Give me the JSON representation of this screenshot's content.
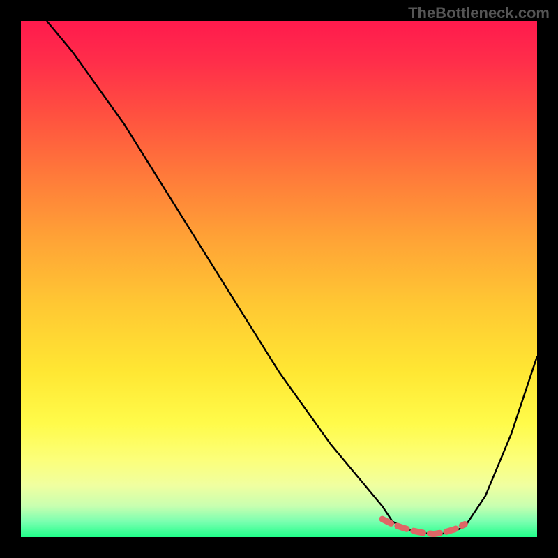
{
  "watermark": "TheBottleneck.com",
  "chart_data": {
    "type": "line",
    "title": "",
    "xlabel": "",
    "ylabel": "",
    "xlim": [
      0,
      100
    ],
    "ylim": [
      0,
      100
    ],
    "grid": false,
    "series": [
      {
        "name": "bottleneck-curve",
        "x": [
          5,
          10,
          15,
          20,
          25,
          30,
          35,
          40,
          45,
          50,
          55,
          60,
          65,
          70,
          72,
          75,
          78,
          80,
          83,
          86,
          90,
          95,
          100
        ],
        "values": [
          100,
          94,
          87,
          80,
          72,
          64,
          56,
          48,
          40,
          32,
          25,
          18,
          12,
          6,
          3,
          1.5,
          0.8,
          0.5,
          0.8,
          2,
          8,
          20,
          35
        ],
        "color": "#000000"
      },
      {
        "name": "optimal-highlight",
        "x": [
          70,
          72,
          74,
          76,
          78,
          80,
          82,
          84,
          86
        ],
        "values": [
          3.5,
          2.5,
          1.8,
          1.2,
          0.8,
          0.6,
          0.9,
          1.5,
          2.5
        ],
        "color": "#e06666"
      }
    ],
    "gradient_stops": [
      {
        "pos": 0,
        "color": "#ff1a4d"
      },
      {
        "pos": 8,
        "color": "#ff2e4a"
      },
      {
        "pos": 18,
        "color": "#ff5040"
      },
      {
        "pos": 30,
        "color": "#ff7a3a"
      },
      {
        "pos": 42,
        "color": "#ffa236"
      },
      {
        "pos": 55,
        "color": "#ffc833"
      },
      {
        "pos": 68,
        "color": "#ffe733"
      },
      {
        "pos": 78,
        "color": "#fffb4a"
      },
      {
        "pos": 85,
        "color": "#fcff7a"
      },
      {
        "pos": 90,
        "color": "#f0ffa0"
      },
      {
        "pos": 94,
        "color": "#c8ffb0"
      },
      {
        "pos": 97,
        "color": "#7affb0"
      },
      {
        "pos": 100,
        "color": "#20ff8a"
      }
    ]
  }
}
